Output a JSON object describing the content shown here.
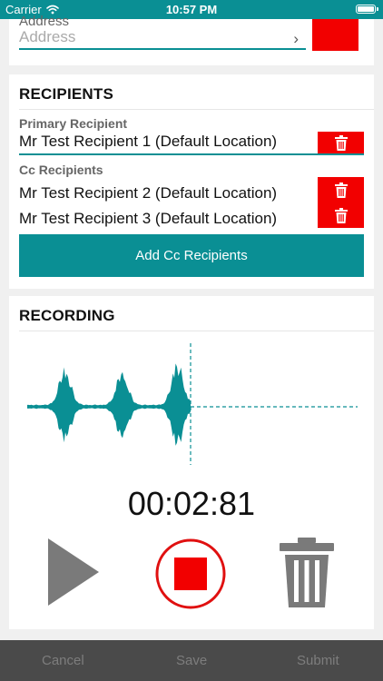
{
  "status_bar": {
    "carrier": "Carrier",
    "time": "10:57 PM"
  },
  "address": {
    "label": "Address",
    "placeholder": "Address"
  },
  "recipients": {
    "title": "RECIPIENTS",
    "primary_label": "Primary Recipient",
    "primary": "Mr Test Recipient 1 (Default Location)",
    "cc_label": "Cc Recipients",
    "cc": [
      "Mr Test Recipient 2 (Default Location)",
      "Mr Test Recipient 3 (Default Location)"
    ],
    "add_cc_label": "Add Cc Recipients"
  },
  "recording": {
    "title": "RECORDING",
    "timer": "00:02:81"
  },
  "footer": {
    "cancel": "Cancel",
    "save": "Save",
    "submit": "Submit"
  },
  "colors": {
    "teal": "#0a8f94",
    "red": "#f20000",
    "gray": "#7a7a7a"
  },
  "icons": [
    "wifi-icon",
    "battery-icon",
    "chevron-right-icon",
    "trash-icon",
    "play-icon",
    "stop-icon"
  ]
}
